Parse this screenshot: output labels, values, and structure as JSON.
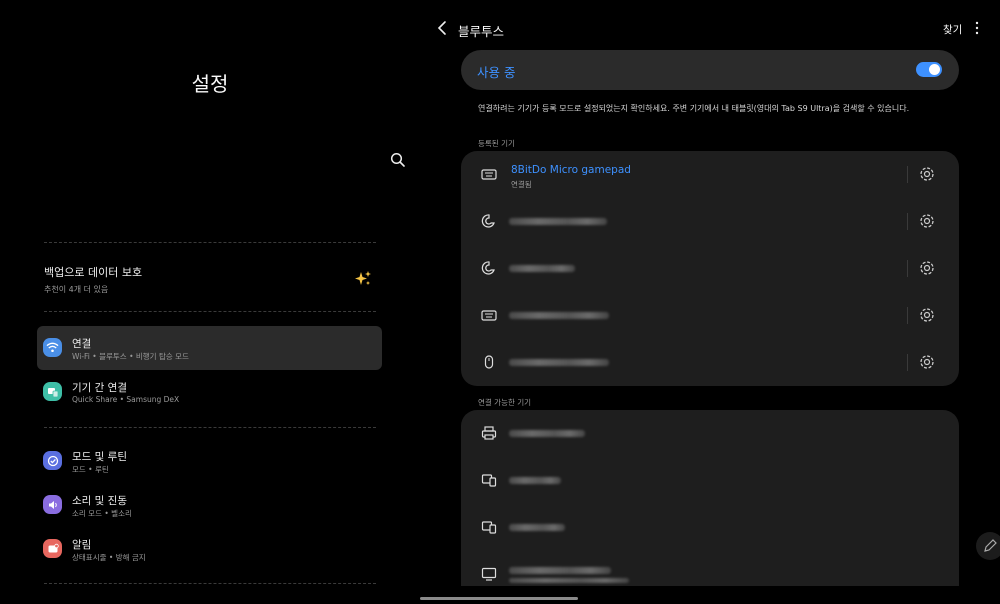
{
  "left": {
    "title": "설정",
    "backup": {
      "title": "백업으로 데이터 보호",
      "subtitle": "추천이 4개 더 있음"
    },
    "menu": [
      {
        "title": "연결",
        "subtitle": "Wi-Fi • 블루투스 • 비행기 탑승 모드",
        "icon": "wifi-icon",
        "color": "#4a8fe7"
      },
      {
        "title": "기기 간 연결",
        "subtitle": "Quick Share • Samsung DeX",
        "icon": "devices-icon",
        "color": "#3ebfa7"
      },
      {
        "title": "모드 및 루틴",
        "subtitle": "모드 • 루틴",
        "icon": "check-circle-icon",
        "color": "#5a6fe0"
      },
      {
        "title": "소리 및 진동",
        "subtitle": "소리 모드 • 벨소리",
        "icon": "speaker-icon",
        "color": "#8a6de0"
      },
      {
        "title": "알림",
        "subtitle": "상태표시줄 • 방해 금지",
        "icon": "bell-icon",
        "color": "#e7675f"
      }
    ]
  },
  "right": {
    "title": "블루투스",
    "find_label": "찾기",
    "toggle_label": "사용 중",
    "toggle_on": true,
    "info_text": "연결하려는 기기가 등록 모드로 설정되었는지 확인하세요. 주변 기기에서 내 태블릿(영대의 Tab S9 Ultra)을 검색할 수 있습니다.",
    "registered_label": "등록된 기기",
    "registered": [
      {
        "name": "8BitDo Micro gamepad",
        "status": "연결됨",
        "icon": "keyboard-icon"
      },
      {
        "name": "",
        "icon": "earbuds-icon"
      },
      {
        "name": "",
        "icon": "earbuds-icon"
      },
      {
        "name": "",
        "icon": "keyboard-icon"
      },
      {
        "name": "",
        "icon": "mouse-icon"
      }
    ],
    "available_label": "연결 가능한 기기",
    "available": [
      {
        "icon": "printer-icon"
      },
      {
        "icon": "devices-icon"
      },
      {
        "icon": "devices-icon"
      },
      {
        "icon": "monitor-icon"
      }
    ]
  },
  "colors": {
    "accent": "#3e91ff",
    "card": "#1e1e1e",
    "selected": "#2b2b2b"
  }
}
